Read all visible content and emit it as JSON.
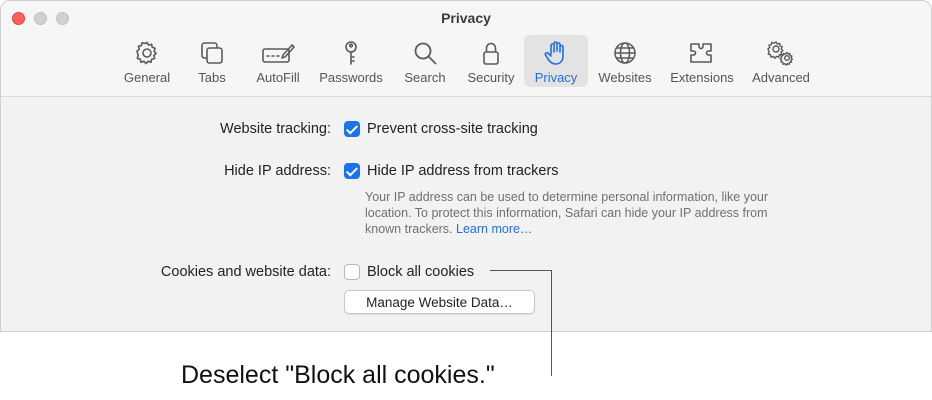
{
  "window": {
    "title": "Privacy"
  },
  "toolbar": {
    "items": [
      {
        "label": "General",
        "icon": "gear-icon"
      },
      {
        "label": "Tabs",
        "icon": "tabs-icon"
      },
      {
        "label": "AutoFill",
        "icon": "autofill-icon"
      },
      {
        "label": "Passwords",
        "icon": "key-icon"
      },
      {
        "label": "Search",
        "icon": "magnifier-icon"
      },
      {
        "label": "Security",
        "icon": "lock-icon"
      },
      {
        "label": "Privacy",
        "icon": "hand-icon",
        "selected": true
      },
      {
        "label": "Websites",
        "icon": "globe-icon"
      },
      {
        "label": "Extensions",
        "icon": "puzzle-icon"
      },
      {
        "label": "Advanced",
        "icon": "gears-icon"
      }
    ],
    "accent_color": "#1f6fe5"
  },
  "settings": {
    "tracking": {
      "label": "Website tracking:",
      "option": "Prevent cross-site tracking",
      "checked": true
    },
    "ip": {
      "label": "Hide IP address:",
      "option": "Hide IP address from trackers",
      "checked": true,
      "help_text": "Your IP address can be used to determine personal information, like your location. To protect this information, Safari can hide your IP address from known trackers.",
      "link": "Learn more…"
    },
    "cookies": {
      "label": "Cookies and website data:",
      "option": "Block all cookies",
      "checked": false,
      "button": "Manage Website Data…"
    }
  },
  "callout": {
    "text": "Deselect \"Block all cookies.\""
  }
}
